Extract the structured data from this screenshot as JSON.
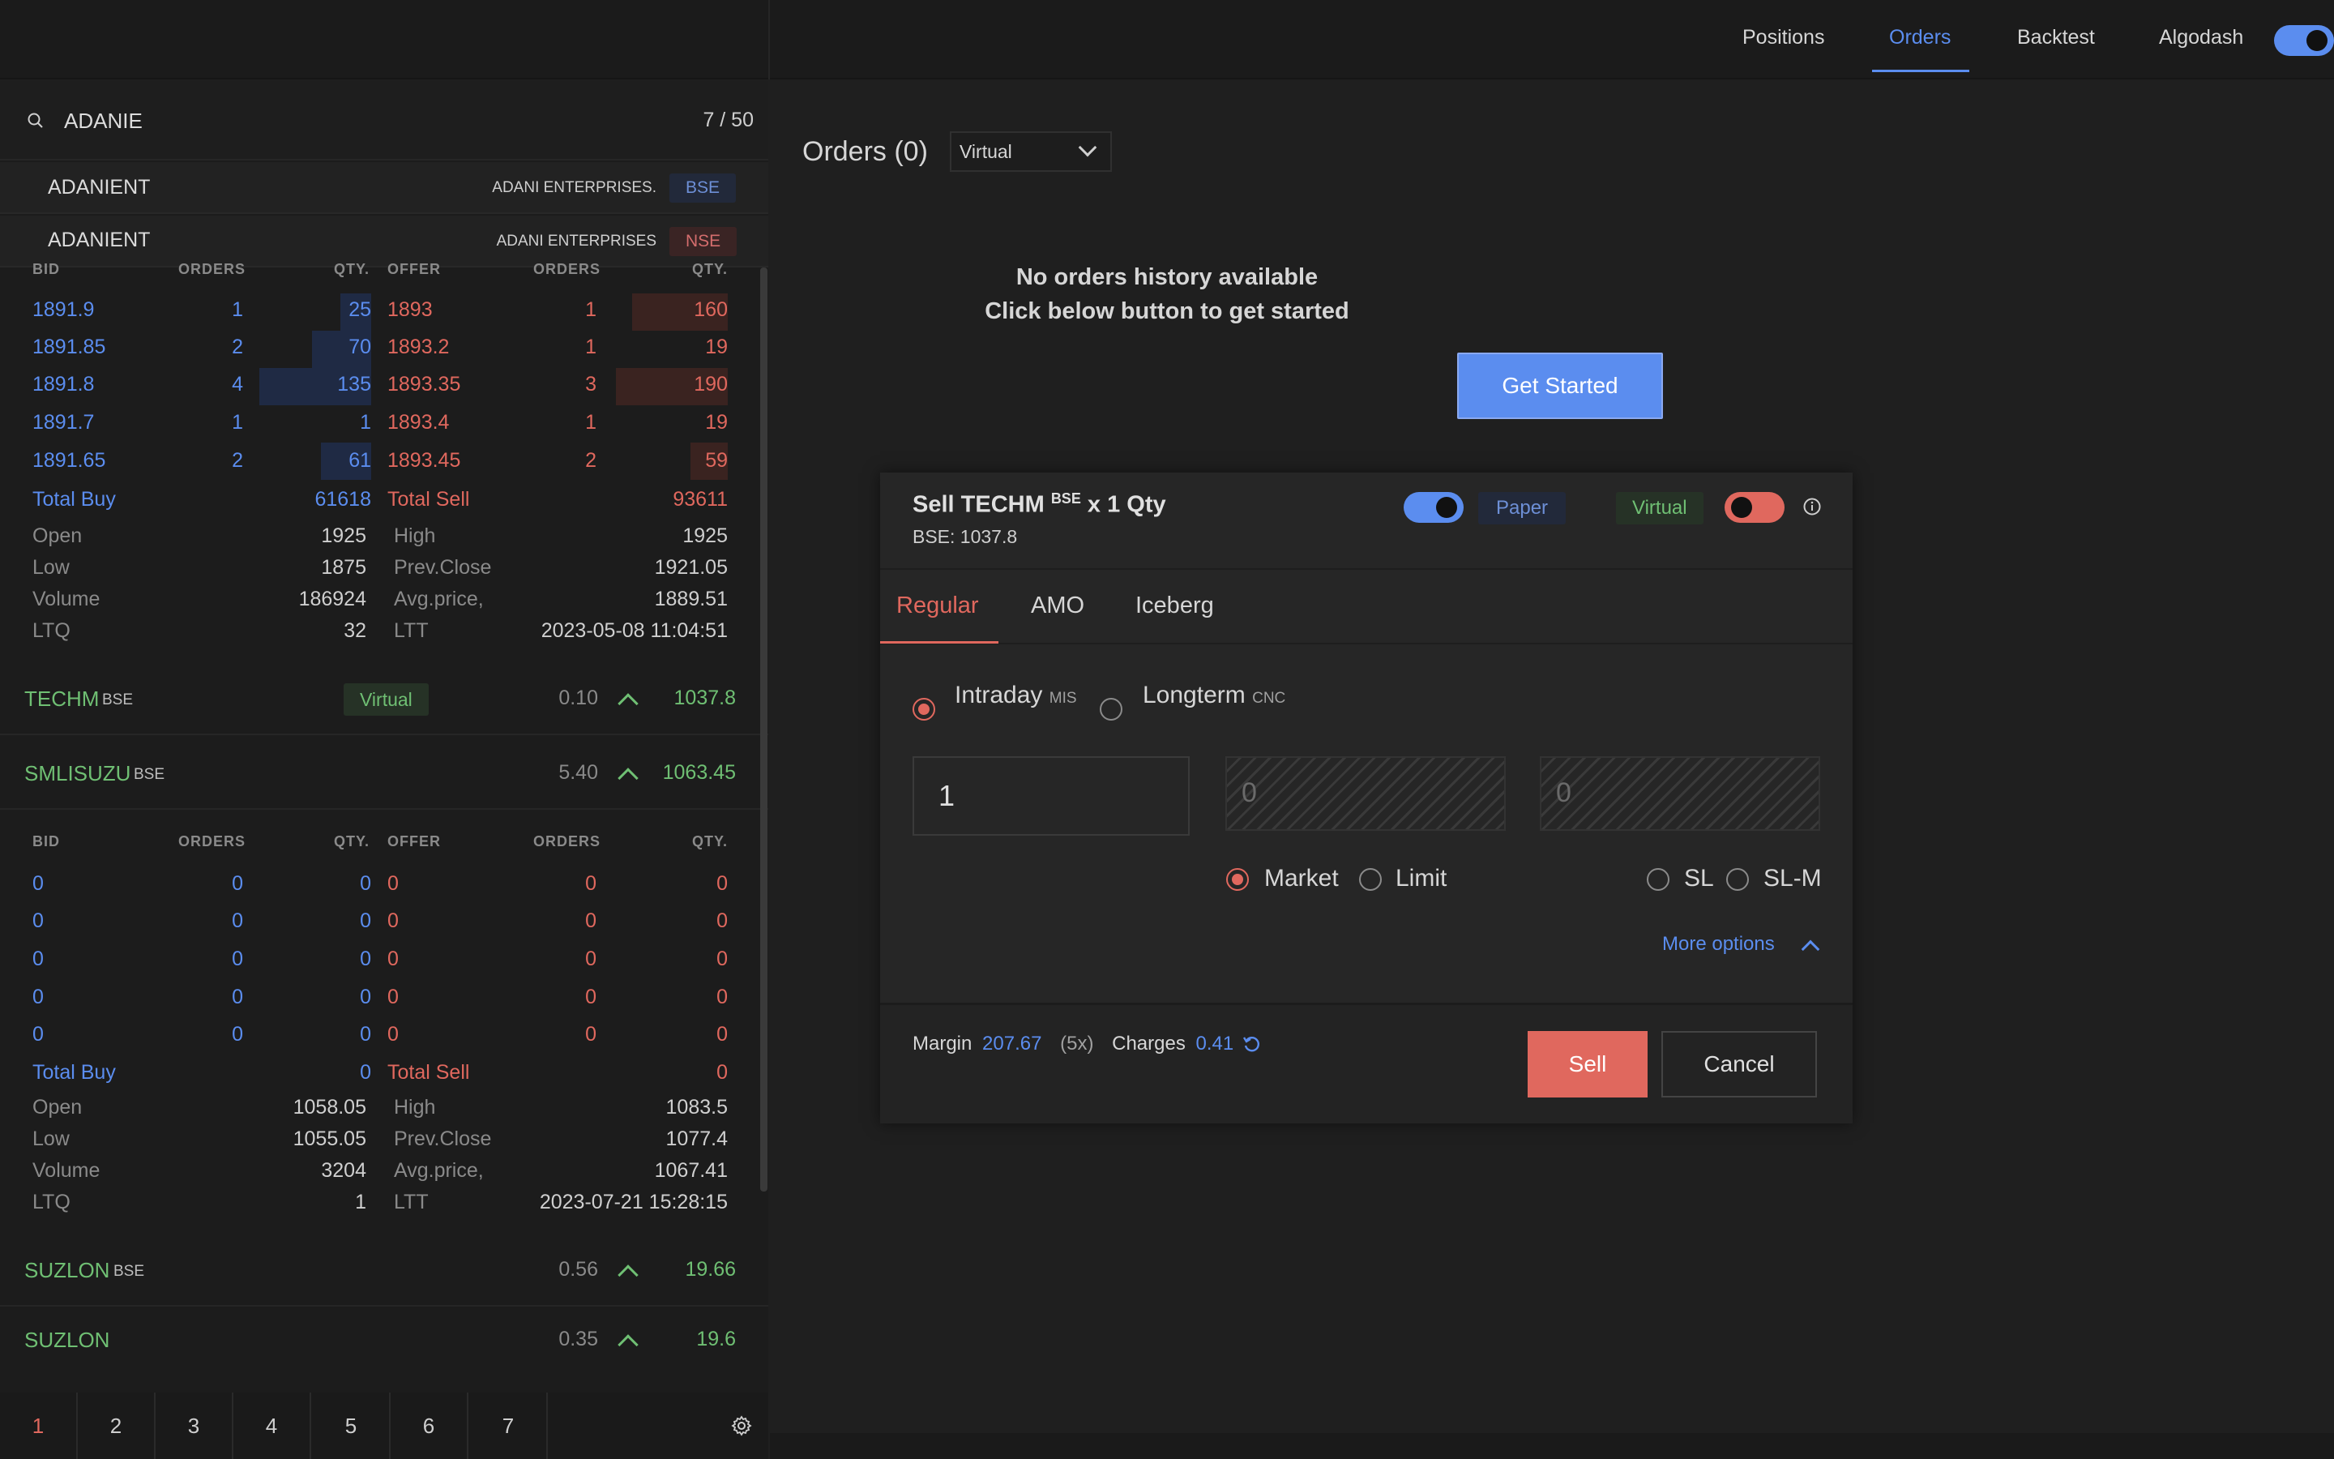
{
  "nav": {
    "items": [
      "Positions",
      "Orders",
      "Backtest",
      "Algodash"
    ],
    "active": "Orders"
  },
  "search": {
    "query": "ADANIE",
    "count": "7 / 50",
    "results": [
      {
        "symbol": "ADANIENT",
        "name": "ADANI ENTERPRISES.",
        "exchange": "BSE"
      },
      {
        "symbol": "ADANIENT",
        "name": "ADANI ENTERPRISES",
        "exchange": "NSE"
      }
    ]
  },
  "depth_headers": {
    "bid": "BID",
    "orders": "ORDERS",
    "qty": "QTY.",
    "offer": "OFFER"
  },
  "depth1": {
    "rows": [
      {
        "bid": "1891.9",
        "bo": "1",
        "bq": "25",
        "offer": "1893",
        "so": "1",
        "sq": "160"
      },
      {
        "bid": "1891.85",
        "bo": "2",
        "bq": "70",
        "offer": "1893.2",
        "so": "1",
        "sq": "19"
      },
      {
        "bid": "1891.8",
        "bo": "4",
        "bq": "135",
        "offer": "1893.35",
        "so": "3",
        "sq": "190"
      },
      {
        "bid": "1891.7",
        "bo": "1",
        "bq": "1",
        "offer": "1893.4",
        "so": "1",
        "sq": "19"
      },
      {
        "bid": "1891.65",
        "bo": "2",
        "bq": "61",
        "offer": "1893.45",
        "so": "2",
        "sq": "59"
      }
    ],
    "total_buy_label": "Total Buy",
    "total_buy": "61618",
    "total_sell_label": "Total Sell",
    "total_sell": "93611",
    "stats": [
      [
        "Open",
        "1925",
        "High",
        "1925"
      ],
      [
        "Low",
        "1875",
        "Prev.Close",
        "1921.05"
      ],
      [
        "Volume",
        "186924",
        "Avg.price,",
        "1889.51"
      ],
      [
        "LTQ",
        "32",
        "LTT",
        "2023-05-08 11:04:51"
      ]
    ]
  },
  "watch1": {
    "symbol": "TECHM",
    "exchange": "BSE",
    "badge": "Virtual",
    "change": "0.10",
    "price": "1037.8"
  },
  "watch2": {
    "symbol": "SMLISUZU",
    "exchange": "BSE",
    "change": "5.40",
    "price": "1063.45"
  },
  "depth2": {
    "rows": [
      {
        "bid": "0",
        "bo": "0",
        "bq": "0",
        "offer": "0",
        "so": "0",
        "sq": "0"
      },
      {
        "bid": "0",
        "bo": "0",
        "bq": "0",
        "offer": "0",
        "so": "0",
        "sq": "0"
      },
      {
        "bid": "0",
        "bo": "0",
        "bq": "0",
        "offer": "0",
        "so": "0",
        "sq": "0"
      },
      {
        "bid": "0",
        "bo": "0",
        "bq": "0",
        "offer": "0",
        "so": "0",
        "sq": "0"
      },
      {
        "bid": "0",
        "bo": "0",
        "bq": "0",
        "offer": "0",
        "so": "0",
        "sq": "0"
      }
    ],
    "total_buy_label": "Total Buy",
    "total_buy": "0",
    "total_sell_label": "Total Sell",
    "total_sell": "0",
    "stats": [
      [
        "Open",
        "1058.05",
        "High",
        "1083.5"
      ],
      [
        "Low",
        "1055.05",
        "Prev.Close",
        "1077.4"
      ],
      [
        "Volume",
        "3204",
        "Avg.price,",
        "1067.41"
      ],
      [
        "LTQ",
        "1",
        "LTT",
        "2023-07-21 15:28:15"
      ]
    ]
  },
  "watch3": {
    "symbol": "SUZLON",
    "exchange": "BSE",
    "change": "0.56",
    "price": "19.66"
  },
  "watch4": {
    "symbol": "SUZLON",
    "change": "0.35",
    "price": "19.6"
  },
  "page_tabs": [
    "1",
    "2",
    "3",
    "4",
    "5",
    "6",
    "7"
  ],
  "orders": {
    "title": "Orders (0)",
    "filter": "Virtual",
    "empty_line1": "No orders history available",
    "empty_line2": "Click below button to get started",
    "cta": "Get Started"
  },
  "modal": {
    "title_prefix": "Sell TECHM",
    "exchange_sup": "BSE",
    "title_suffix": "x 1 Qty",
    "subtitle": "BSE: 1037.8",
    "paper_label": "Paper",
    "virtual_label": "Virtual",
    "tabs": [
      "Regular",
      "AMO",
      "Iceberg"
    ],
    "product_intraday": "Intraday",
    "product_intraday_sub": "MIS",
    "product_longterm": "Longterm",
    "product_longterm_sub": "CNC",
    "qty": "1",
    "price": "0",
    "trigger": "0",
    "order_market": "Market",
    "order_limit": "Limit",
    "order_sl": "SL",
    "order_slm": "SL-M",
    "more_options": "More options",
    "margin_label": "Margin",
    "margin": "207.67",
    "leverage": "(5x)",
    "charges_label": "Charges",
    "charges": "0.41",
    "sell_btn": "Sell",
    "cancel_btn": "Cancel"
  },
  "colors": {
    "accent": "#5b8def",
    "sell": "#e0685e",
    "buy_text": "#5b8def",
    "up": "#6fbf73"
  }
}
